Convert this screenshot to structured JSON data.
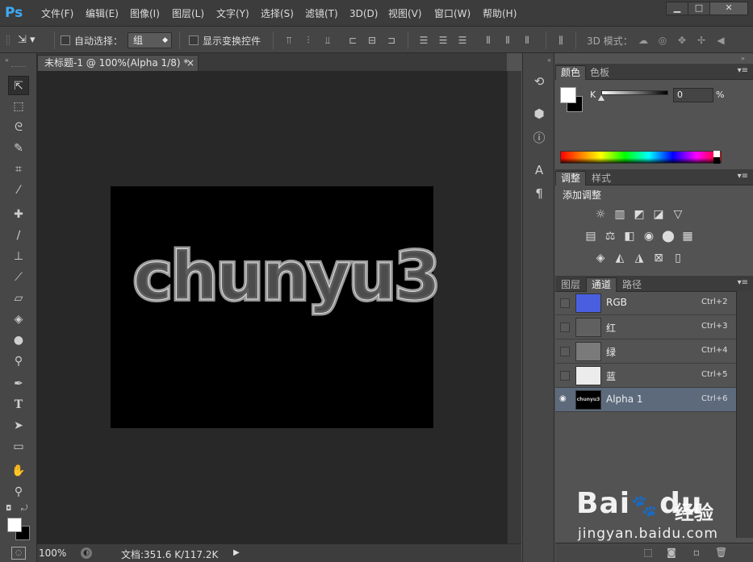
{
  "app": {
    "logo": "Ps"
  },
  "menu": [
    "文件(F)",
    "编辑(E)",
    "图像(I)",
    "图层(L)",
    "文字(Y)",
    "选择(S)",
    "滤镜(T)",
    "3D(D)",
    "视图(V)",
    "窗口(W)",
    "帮助(H)"
  ],
  "window_controls": {
    "minimize": "▁",
    "maximize": "□",
    "close": "✕"
  },
  "options": {
    "auto_select_label": "自动选择：",
    "group_value": "组",
    "transform_label": "显示变换控件",
    "mode_3d_label": "3D 模式："
  },
  "document": {
    "tab_title": "未标题-1 @ 100%(Alpha 1/8) *",
    "tab_close": "×",
    "canvas_text": "chunyu3"
  },
  "status": {
    "zoom": "100%",
    "doc_info": "文档:351.6 K/117.2K",
    "arrow": "▶"
  },
  "color_panel": {
    "tabs": [
      "颜色",
      "色板"
    ],
    "channel_label": "K",
    "value": "0",
    "unit": "%",
    "value_fraction": 0
  },
  "adjust_panel": {
    "tabs": [
      "调整",
      "样式"
    ],
    "title": "添加调整"
  },
  "channels_panel": {
    "tabs": [
      "图层",
      "通道",
      "路径"
    ],
    "rows": [
      {
        "name": "RGB",
        "key": "Ctrl+2",
        "thumb": "#4a5fe0"
      },
      {
        "name": "红",
        "key": "Ctrl+3",
        "thumb": "#606060"
      },
      {
        "name": "绿",
        "key": "Ctrl+4",
        "thumb": "#7a7a7a"
      },
      {
        "name": "蓝",
        "key": "Ctrl+5",
        "thumb": "#ececec"
      },
      {
        "name": "Alpha 1",
        "key": "Ctrl+6",
        "thumb": "#000000",
        "thumb_text": "chunyu3"
      }
    ]
  },
  "watermark": {
    "brand": "Bai",
    "brand2": "du",
    "brand_cn": "经验",
    "url": "jingyan.baidu.com"
  },
  "colors": {
    "ps_blue": "#3fa9f5",
    "selected_row": "#5c6a7c",
    "watermark": "#ffffff"
  }
}
